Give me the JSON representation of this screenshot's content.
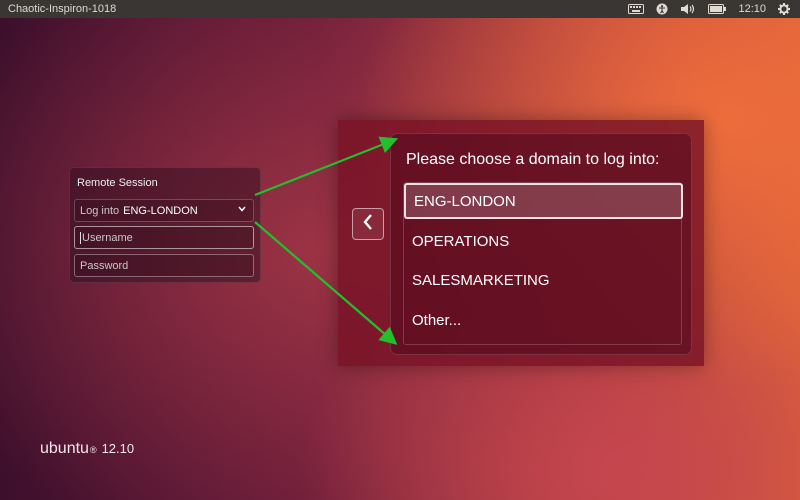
{
  "panel": {
    "hostname": "Chaotic-Inspiron-1018",
    "indicators": [
      {
        "icon": "keyboard-icon"
      },
      {
        "icon": "accessibility-icon"
      },
      {
        "icon": "volume-icon"
      },
      {
        "icon": "battery-icon"
      }
    ],
    "clock": "12:10",
    "session_icon": "gear-icon"
  },
  "login": {
    "title": "Remote Session",
    "domain_field": {
      "prefix": "Log into",
      "value": "ENG-LONDON"
    },
    "username_placeholder": "Username",
    "password_placeholder": "Password"
  },
  "domain_chooser": {
    "prompt": "Please choose a domain to log into:",
    "items": [
      {
        "label": "ENG-LONDON",
        "selected": true
      },
      {
        "label": "OPERATIONS",
        "selected": false
      },
      {
        "label": "SALESMARKETING",
        "selected": false
      },
      {
        "label": "Other...",
        "selected": false
      }
    ]
  },
  "brand": {
    "name": "ubuntu",
    "mark": "®",
    "version": "12.10"
  },
  "colors": {
    "arrow": "#22c02c",
    "panel_bg": "#3a3633"
  }
}
